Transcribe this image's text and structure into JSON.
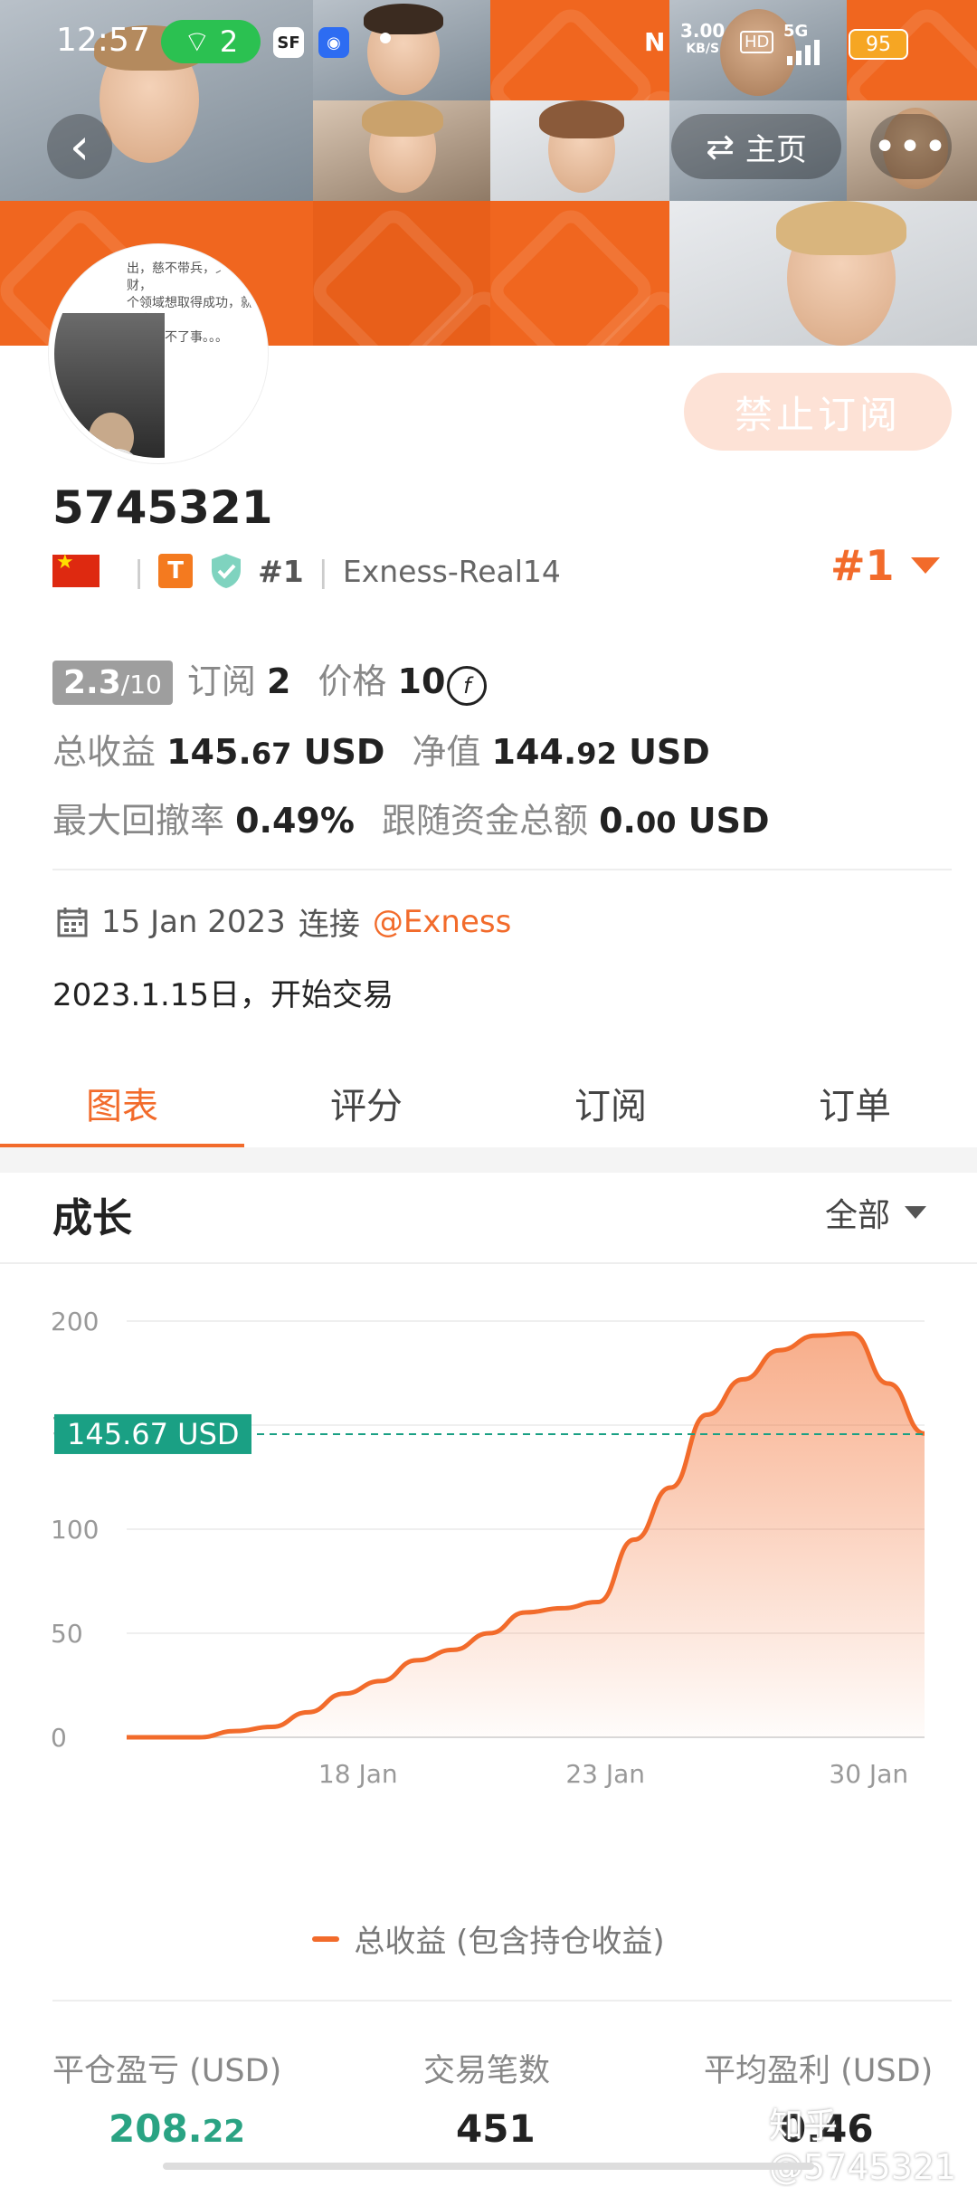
{
  "status_bar": {
    "time": "12:57",
    "hotspot_count": "2",
    "net_speed": "3.00",
    "net_unit": "KB/S",
    "hd": "HD",
    "network": "5G",
    "battery": "95"
  },
  "header": {
    "home_label": "主页",
    "more_label": "•••",
    "unsubscribe_label": "禁止订阅"
  },
  "avatar": {
    "text": "出，慈不带兵，义不掌财，\n个领域想取得成功，就要舍得\n好人成不了事。。。"
  },
  "profile": {
    "account_id": "5745321",
    "level_badge": "T",
    "rank": "#1",
    "server": "Exness-Real14",
    "rank_right": "#1"
  },
  "stats": {
    "score": "2.3",
    "score_max": "/10",
    "subscriptions_label": "订阅",
    "subscriptions_value": "2",
    "price_label": "价格",
    "price_value": "10",
    "price_coin": "f",
    "total_profit_label": "总收益",
    "total_profit_int": "145.",
    "total_profit_dec": "67",
    "total_profit_unit": "USD",
    "equity_label": "净值",
    "equity_int": "144.",
    "equity_dec": "92",
    "equity_unit": "USD",
    "max_drawdown_label": "最大回撤率",
    "max_drawdown_value": "0.49%",
    "follow_funds_label": "跟随资金总额",
    "follow_funds_int": "0.",
    "follow_funds_dec": "00",
    "follow_funds_unit": "USD"
  },
  "connection": {
    "date": "15 Jan 2023",
    "connect_label": "连接",
    "broker": "@Exness"
  },
  "description": "2023.1.15日，开始交易",
  "tabs": [
    {
      "label": "图表",
      "active": true
    },
    {
      "label": "评分",
      "active": false
    },
    {
      "label": "订阅",
      "active": false
    },
    {
      "label": "订单",
      "active": false
    }
  ],
  "chart_section": {
    "title": "成长",
    "period": "全部"
  },
  "chart_data": {
    "type": "area",
    "x": [
      "2023-01-15",
      "2023-01-16",
      "2023-01-17",
      "2023-01-18",
      "2023-01-19",
      "2023-01-20",
      "2023-01-21",
      "2023-01-22",
      "2023-01-23",
      "2023-01-24",
      "2023-01-25",
      "2023-01-26",
      "2023-01-27",
      "2023-01-28",
      "2023-01-29",
      "2023-01-30"
    ],
    "series": [
      {
        "name": "总收益 (包含持仓收益)",
        "values": [
          0,
          0,
          0,
          3,
          5,
          12,
          21,
          27,
          37,
          42,
          50,
          60,
          62,
          65,
          95,
          120,
          155,
          172,
          186,
          193,
          194,
          170,
          146
        ]
      }
    ],
    "x_ticks": [
      "18 Jan",
      "23 Jan",
      "30 Jan"
    ],
    "y_ticks": [
      "0",
      "50",
      "100",
      "150",
      "200"
    ],
    "ylim": [
      0,
      200
    ],
    "reference_line": {
      "value": 145.67,
      "label": "145.67 USD"
    },
    "color": "#f26b2b",
    "reference_color": "#1aa084",
    "legend": "bottom-center",
    "grid": true
  },
  "bottom_stats": {
    "closed_pnl_label": "平仓盈亏 (USD)",
    "closed_pnl_int": "208.",
    "closed_pnl_dec": "22",
    "trades_label": "交易笔数",
    "trades_value": "451",
    "avg_profit_label": "平均盈利 (USD)",
    "avg_profit_value": "0.46"
  },
  "watermark": "知乎 @5745321"
}
